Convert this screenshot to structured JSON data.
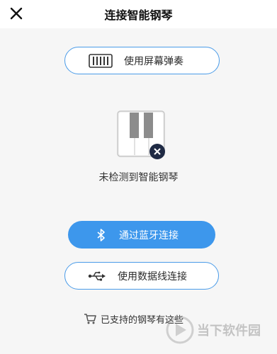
{
  "header": {
    "title": "连接智能钢琴",
    "close_icon": "close-icon"
  },
  "screen_play": {
    "label": "使用屏幕弹奏",
    "icon": "piano-keyboard-icon"
  },
  "status": {
    "text": "未检测到智能钢琴",
    "icon": "piano-disconnected-icon"
  },
  "bluetooth": {
    "label": "通过蓝牙连接",
    "icon": "bluetooth-icon"
  },
  "usb": {
    "label": "使用数据线连接",
    "icon": "usb-icon"
  },
  "supported": {
    "label": "已支持的钢琴有这些",
    "icon": "cart-icon"
  },
  "watermark": {
    "text": "当下软件园"
  },
  "colors": {
    "accent": "#3d97ec",
    "background": "#f6f6f6",
    "outline": "#4a9be8"
  }
}
